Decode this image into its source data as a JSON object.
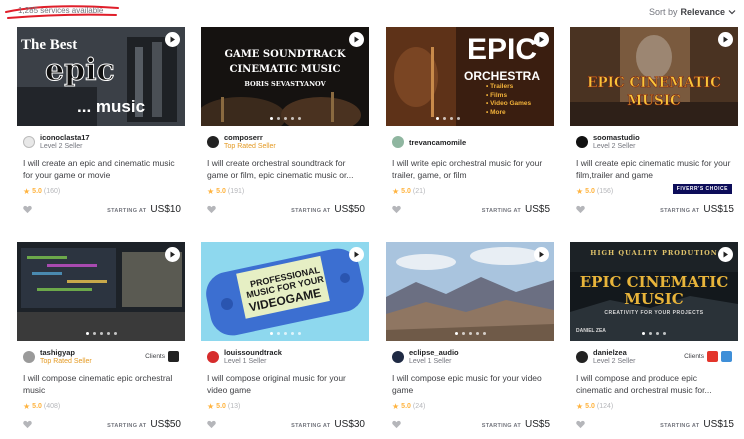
{
  "header": {
    "services_count": "1,285 services available",
    "sort_by_label": "Sort by",
    "sort_value": "Relevance"
  },
  "labels": {
    "starting_at": "STARTING AT",
    "clients": "Clients",
    "fiverrs_choice": "FIVERR'S CHOICE"
  },
  "cards": [
    {
      "thumb_title_line1": "The Best",
      "thumb_title_line2": "epic",
      "thumb_title_line3": "... music",
      "seller": "iconoclasta17",
      "level": "Level 2 Seller",
      "title": "I will create an epic and cinematic music for your game or movie",
      "rating": "5.0",
      "reviews": "(160)",
      "price": "US$10"
    },
    {
      "thumb_title_line1": "GAME SOUNDTRACK",
      "thumb_title_line2": "CINEMATIC MUSIC",
      "thumb_title_line3": "BORIS SEVASTYANOV",
      "seller": "composerr",
      "level": "Top Rated Seller",
      "title": "I will create orchestral soundtrack for game or film, epic cinematic music or...",
      "rating": "5.0",
      "reviews": "(191)",
      "price": "US$50"
    },
    {
      "thumb_title_line1": "EPIC",
      "thumb_title_line2": "ORCHESTRA",
      "thumb_list": [
        "• Trailers",
        "• Films",
        "• Video Games",
        "• More"
      ],
      "seller": "trevancamomile",
      "level": "",
      "title": "I will write epic orchestral music for your trailer, game, or film",
      "rating": "5.0",
      "reviews": "(21)",
      "price": "US$5"
    },
    {
      "thumb_title_line1": "EPIC CINEMATIC",
      "thumb_title_line2": "MUSIC",
      "seller": "soomastudio",
      "level": "Level 2 Seller",
      "title": "I will create epic cinematic music for your film,trailer and game",
      "rating": "5.0",
      "reviews": "(156)",
      "price": "US$15"
    },
    {
      "seller": "tashigyap",
      "level": "Top Rated Seller",
      "title": "I will compose cinematic epic orchestral music",
      "rating": "5.0",
      "reviews": "(408)",
      "price": "US$50"
    },
    {
      "thumb_title_line1": "PROFESSIONAL",
      "thumb_title_line2": "MUSIC FOR YOUR",
      "thumb_title_line3": "VIDEOGAME",
      "seller": "louissoundtrack",
      "level": "Level 1 Seller",
      "title": "I will compose original music for your video game",
      "rating": "5.0",
      "reviews": "(13)",
      "price": "US$30"
    },
    {
      "seller": "eclipse_audio",
      "level": "Level 1 Seller",
      "title": "I will compose epic music for your video game",
      "rating": "5.0",
      "reviews": "(24)",
      "price": "US$5"
    },
    {
      "thumb_title_line1": "HIGH QUALITY PRODUTION",
      "thumb_title_line2": "EPIC CINEMATIC",
      "thumb_title_line3": "MUSIC",
      "thumb_title_line4": "CREATIVITY FOR YOUR PROJECTS",
      "thumb_title_line5": "DANIEL ZEA",
      "seller": "danielzea",
      "level": "Level 2 Seller",
      "title": "I will compose and produce epic cinematic and orchestral music for...",
      "rating": "5.0",
      "reviews": "(124)",
      "price": "US$15"
    }
  ],
  "colors": {
    "rating_star": "#ffb33e",
    "top_rated": "#e49a23",
    "choice_badge": "#0d0d59"
  }
}
